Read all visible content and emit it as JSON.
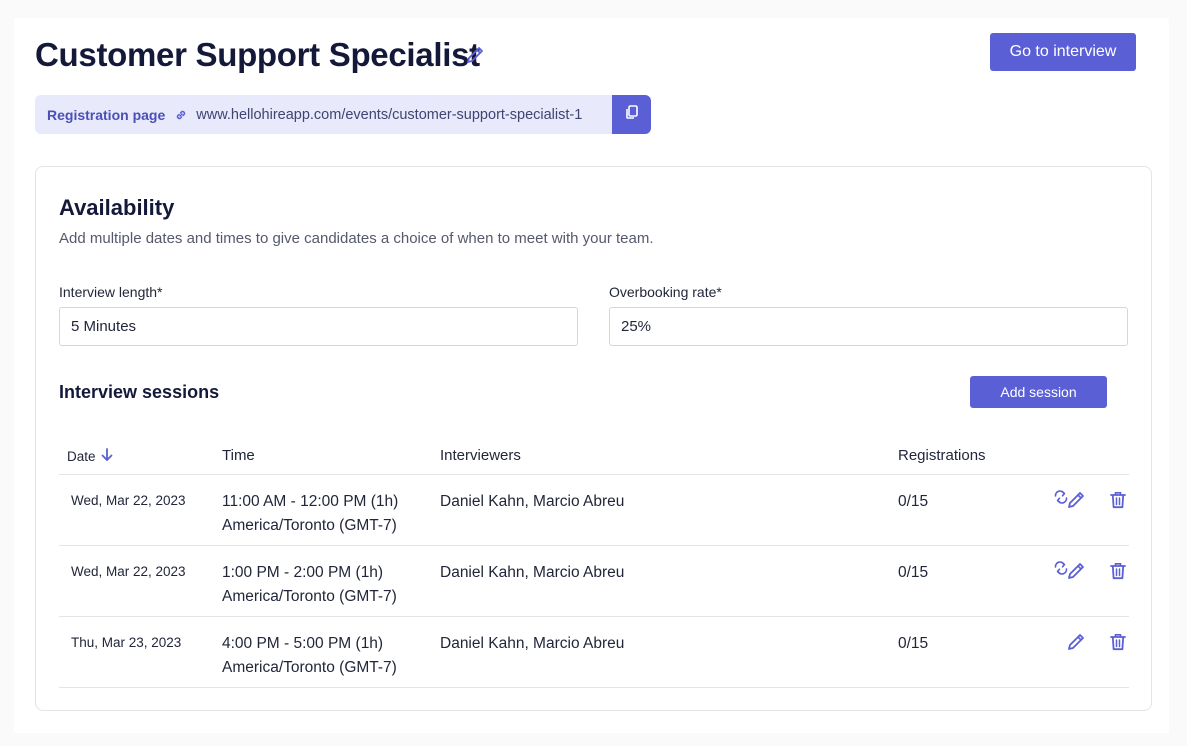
{
  "header": {
    "title": "Customer Support Specialist",
    "goto_label": "Go to interview"
  },
  "registration": {
    "label": "Registration page",
    "url": "www.hellohireapp.com/events/customer-support-specialist-1"
  },
  "availability": {
    "title": "Availability",
    "subtitle": "Add multiple dates and times to give candidates a choice of when to meet with your team.",
    "interview_length": {
      "label": "Interview length*",
      "value": "5 Minutes"
    },
    "overbooking_rate": {
      "label": "Overbooking rate*",
      "value": "25%"
    }
  },
  "sessions": {
    "title": "Interview sessions",
    "add_label": "Add session",
    "columns": {
      "date": "Date",
      "time": "Time",
      "interviewers": "Interviewers",
      "registrations": "Registrations"
    },
    "rows": [
      {
        "date": "Wed, Mar 22, 2023",
        "time": "11:00 AM - 12:00 PM (1h)",
        "timezone": "America/Toronto (GMT-7)",
        "interviewers": "Daniel Kahn, Marcio Abreu",
        "registrations": "0/15",
        "recurring": true
      },
      {
        "date": "Wed, Mar 22, 2023",
        "time": "1:00 PM - 2:00 PM (1h)",
        "timezone": "America/Toronto (GMT-7)",
        "interviewers": "Daniel Kahn, Marcio Abreu",
        "registrations": "0/15",
        "recurring": true
      },
      {
        "date": "Thu, Mar 23, 2023",
        "time": "4:00 PM - 5:00 PM (1h)",
        "timezone": "America/Toronto (GMT-7)",
        "interviewers": "Daniel Kahn, Marcio Abreu",
        "registrations": "0/15",
        "recurring": false
      }
    ]
  },
  "icons": {
    "title_edit": "pencil-icon",
    "link": "link-icon",
    "copy": "copy-icon",
    "sort": "arrow-down-icon",
    "recurring": "repeat-icon",
    "edit": "pencil-icon",
    "delete": "trash-icon"
  },
  "colors": {
    "accent": "#5b5fd6",
    "title": "#14193a",
    "registration_bg": "#e8e9fb"
  }
}
